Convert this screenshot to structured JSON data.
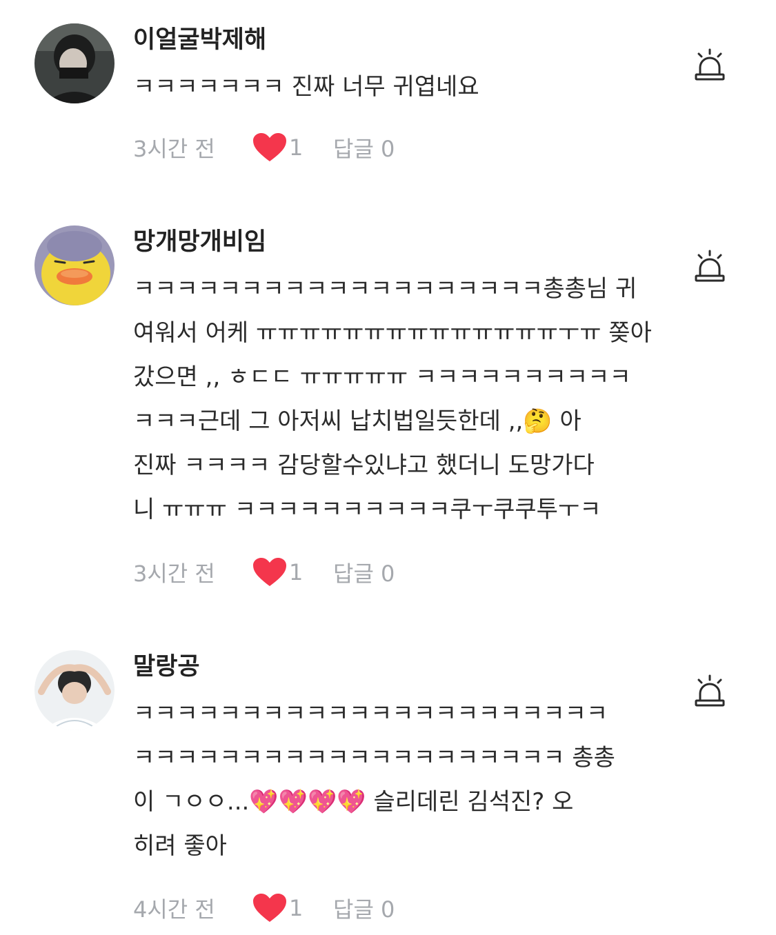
{
  "comments": [
    {
      "username": "이얼굴박제해",
      "text": "ㅋㅋㅋㅋㅋㅋㅋ 진짜 너무 귀엽네요",
      "time": "3시간 전",
      "likes": "1",
      "replies": "답글 0",
      "avatar_icon": "avatar-photo-person-icon"
    },
    {
      "username": "망개망개비임",
      "text": "ㅋㅋㅋㅋㅋㅋㅋㅋㅋㅋㅋㅋㅋㅋㅋㅋㅋㅋㅋ총총님 귀\n여워서 어케 ㅠㅠㅠㅠㅠㅠㅠㅠㅠㅠㅠㅠㅠㅠㅜㅠ 쫒아\n갔으면 ,, ㅎㄷㄷ ㅠㅠㅠㅠㅠ ㅋㅋㅋㅋㅋㅋㅋㅋㅋㅋ\nㅋㅋㅋ근데 그 아저씨 납치법일듯한데 ,,🤔 아\n진짜 ㅋㅋㅋㅋ 감당할수있냐고 했더니 도망가다\n니 ㅠㅠㅠ ㅋㅋㅋㅋㅋㅋㅋㅋㅋㅋ쿠ㅜ쿠쿠투ㅜㅋ",
      "time": "3시간 전",
      "likes": "1",
      "replies": "답글 0",
      "avatar_icon": "avatar-duck-icon"
    },
    {
      "username": "말랑공",
      "text": "ㅋㅋㅋㅋㅋㅋㅋㅋㅋㅋㅋㅋㅋㅋㅋㅋㅋㅋㅋㅋㅋㅋ\nㅋㅋㅋㅋㅋㅋㅋㅋㅋㅋㅋㅋㅋㅋㅋㅋㅋㅋㅋㅋ 총총\n이 ㄱㅇㅇ...💖💖💖💖 슬리데린 김석진? 오\n히려 좋아",
      "time": "4시간 전",
      "likes": "1",
      "replies": "답글 0",
      "avatar_icon": "avatar-photo-person-icon"
    }
  ],
  "icons": {
    "report": "siren-report-icon",
    "like": "heart-icon"
  },
  "colors": {
    "heart": "#f4364c",
    "meta_text": "#a5a8ad",
    "username": "#222222",
    "body_text": "#2b2b2b"
  }
}
